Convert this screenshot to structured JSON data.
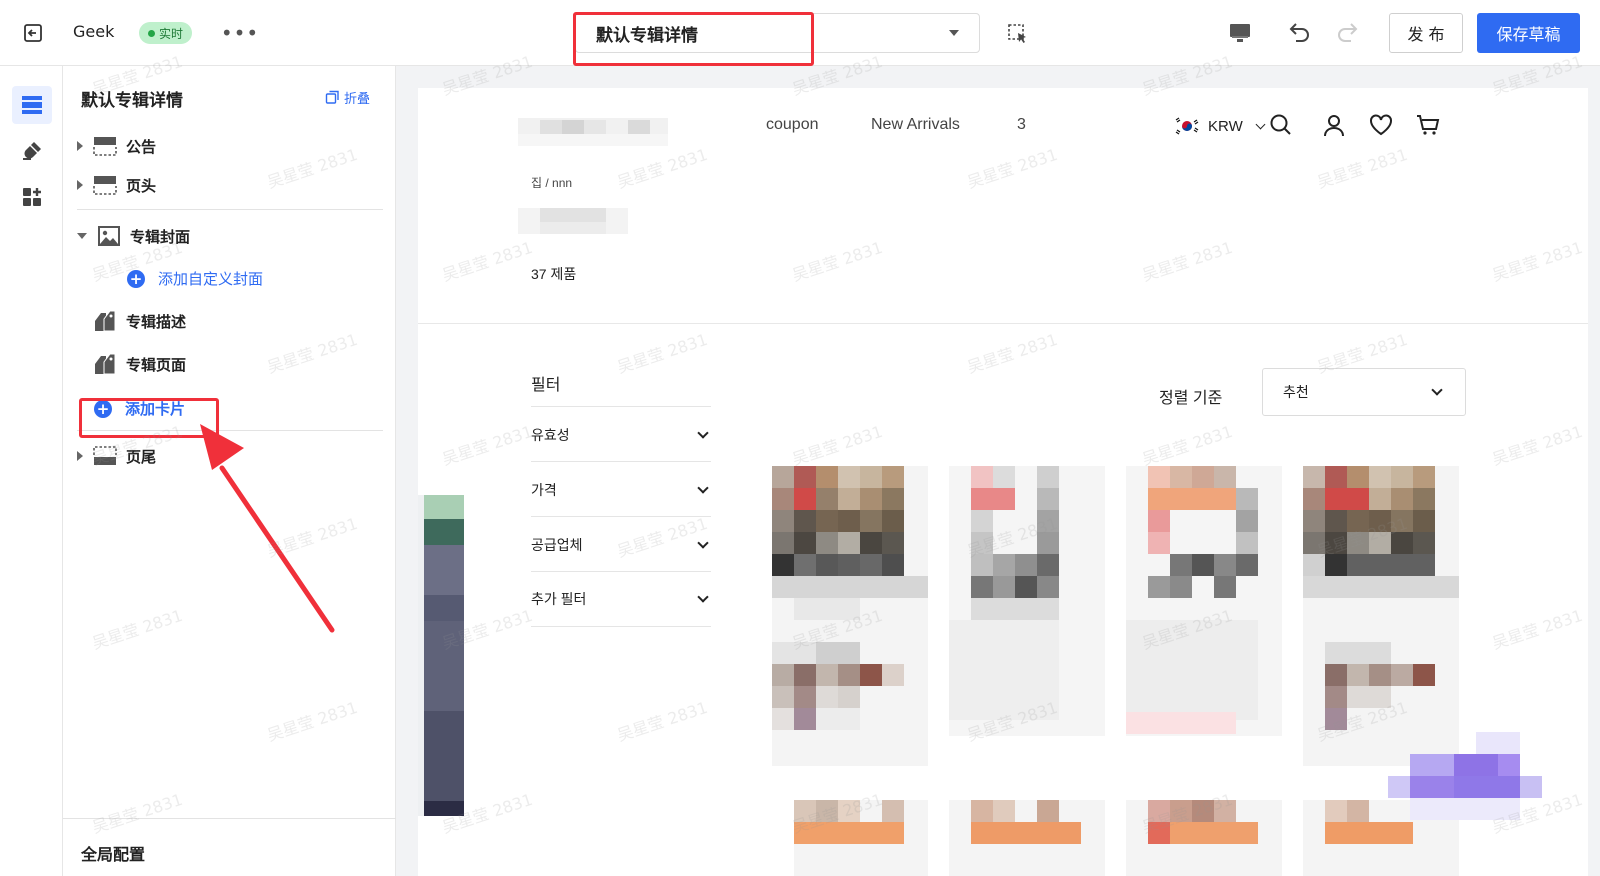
{
  "topbar": {
    "app_name": "Geek",
    "live_label": "实时",
    "page_select_value": "默认专辑详情",
    "publish_label": "发 布",
    "save_label": "保存草稿"
  },
  "sidebar": {
    "title": "默认专辑详情",
    "collapse_label": "折叠",
    "items": [
      {
        "label": "公告",
        "expand": "collapsed",
        "icon": "layout-block-icon"
      },
      {
        "label": "页头",
        "expand": "collapsed",
        "icon": "header-block-icon"
      },
      {
        "label": "专辑封面",
        "expand": "expanded",
        "icon": "image-icon"
      },
      {
        "label": "添加自定义封面",
        "icon": "plus-circle-icon"
      },
      {
        "label": "专辑描述",
        "icon": "tags-icon"
      },
      {
        "label": "专辑页面",
        "icon": "tags-icon"
      },
      {
        "label": "添加卡片",
        "icon": "plus-circle-icon"
      },
      {
        "label": "页尾",
        "expand": "collapsed",
        "icon": "footer-block-icon"
      }
    ],
    "footer_label": "全局配置"
  },
  "preview": {
    "nav": [
      "coupon",
      "New Arrivals",
      "3"
    ],
    "currency": "KRW",
    "breadcrumb": "집 / nnn",
    "product_count": "37 제품",
    "filter_title": "필터",
    "filters": [
      "유효성",
      "가격",
      "공급업체",
      "추가 필터"
    ],
    "sort_label": "정렬 기준",
    "sort_value": "추천"
  },
  "watermark": "吴星莹 2831",
  "colors": {
    "accent": "#2f6bf2",
    "highlight": "#f0303a",
    "live_bg": "#bff0cc"
  }
}
